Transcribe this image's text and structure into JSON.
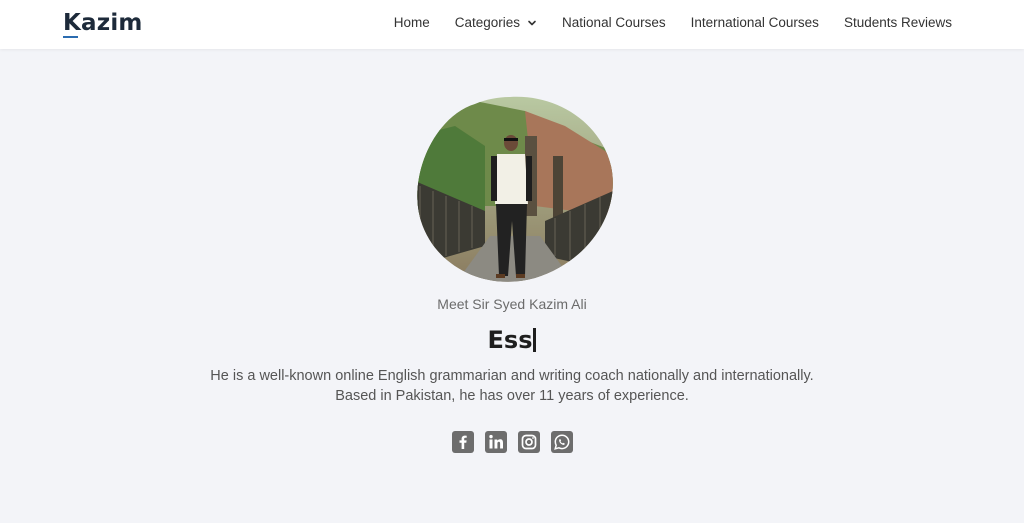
{
  "brand": {
    "logo_text": "Kazim"
  },
  "nav": {
    "items": [
      {
        "label": "Home"
      },
      {
        "label": "Categories",
        "has_dropdown": true
      },
      {
        "label": "National Courses"
      },
      {
        "label": "International Courses"
      },
      {
        "label": "Students Reviews"
      }
    ]
  },
  "hero": {
    "meet_text": "Meet Sir Syed Kazim Ali",
    "typed_text": "Ess",
    "description_line1": "He is a well-known online English grammarian and writing coach nationally and internationally.",
    "description_line2": "Based in Pakistan, he has over 11 years of experience."
  },
  "social": {
    "icons": [
      "facebook-icon",
      "linkedin-icon",
      "instagram-icon",
      "whatsapp-icon"
    ]
  },
  "colors": {
    "page_background": "#f3f4f8",
    "navbar_background": "#ffffff",
    "icon_gray": "#6d6d6d",
    "logo_accent": "#2b6cb0"
  }
}
